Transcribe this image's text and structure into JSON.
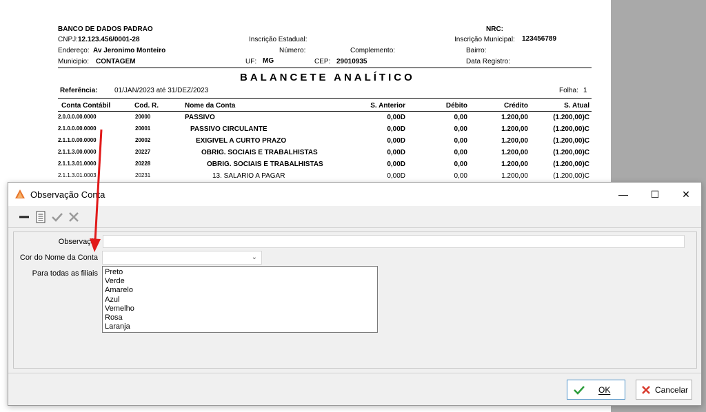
{
  "report": {
    "company": "BANCO DE DADOS PADRAO",
    "nrc_label": "NRC:",
    "cnpj_label": "CNPJ:",
    "cnpj": "12.123.456/0001-28",
    "ie_label": "Inscrição Estadual:",
    "im_label": "Inscrição Municipal:",
    "im": "123456789",
    "endereco_label": "Endereço:",
    "endereco": "Av Jeronimo Monteiro",
    "numero_label": "Número:",
    "complemento_label": "Complemento:",
    "bairro_label": "Bairro:",
    "municipio_label": "Municipio:",
    "municipio": "CONTAGEM",
    "uf_label": "UF:",
    "uf": "MG",
    "cep_label": "CEP:",
    "cep": "29010935",
    "data_registro_label": "Data Registro:",
    "title": "BALANCETE ANALÍTICO",
    "referencia_label": "Referência:",
    "referencia": "01/JAN/2023 até 31/DEZ/2023",
    "folha_label": "Folha:",
    "folha": "1",
    "columns": [
      "Conta Contábil",
      "Cod. R.",
      "Nome da Conta",
      "S. Anterior",
      "Débito",
      "Crédito",
      "S. Atual"
    ],
    "rows": [
      {
        "conta": "2.0.0.0.00.0000",
        "cod": "20000",
        "nome": "PASSIVO",
        "anterior": "0,00D",
        "debito": "0,00",
        "credito": "1.200,00",
        "atual": "(1.200,00)C"
      },
      {
        "conta": "2.1.0.0.00.0000",
        "cod": "20001",
        "nome": "PASSIVO CIRCULANTE",
        "anterior": "0,00D",
        "debito": "0,00",
        "credito": "1.200,00",
        "atual": "(1.200,00)C"
      },
      {
        "conta": "2.1.1.0.00.0000",
        "cod": "20002",
        "nome": "EXIGIVEL A CURTO PRAZO",
        "anterior": "0,00D",
        "debito": "0,00",
        "credito": "1.200,00",
        "atual": "(1.200,00)C"
      },
      {
        "conta": "2.1.1.3.00.0000",
        "cod": "20227",
        "nome": "OBRIG. SOCIAIS E TRABALHISTAS",
        "anterior": "0,00D",
        "debito": "0,00",
        "credito": "1.200,00",
        "atual": "(1.200,00)C"
      },
      {
        "conta": "2.1.1.3.01.0000",
        "cod": "20228",
        "nome": "OBRIG. SOCIAIS E TRABALHISTAS",
        "anterior": "0,00D",
        "debito": "0,00",
        "credito": "1.200,00",
        "atual": "(1.200,00)C"
      },
      {
        "conta": "2.1.1.3.01.0003",
        "cod": "20231",
        "nome": "13. SALARIO A PAGAR",
        "anterior": "0,00D",
        "debito": "0,00",
        "credito": "1.200,00",
        "atual": "(1.200,00)C"
      }
    ]
  },
  "dialog": {
    "title": "Observação Conta",
    "minimize": "—",
    "maximize": "☐",
    "close": "✕",
    "observacao_label": "Observação",
    "observacao_value": "",
    "cor_label": "Cor do Nome da Conta",
    "cor_value": "",
    "filiais_label": "Para todas as filiais",
    "cor_options": [
      "Preto",
      "Verde",
      "Amarelo",
      "Azul",
      "Vemelho",
      "Rosa",
      "Laranja"
    ],
    "ok_label": "OK",
    "cancel_label": "Cancelar"
  },
  "colors": {
    "accent_red": "#e11a1a",
    "ok_check": "#2e9e3e",
    "cancel_x": "#d8372a",
    "app_icon": "#e8732a"
  }
}
